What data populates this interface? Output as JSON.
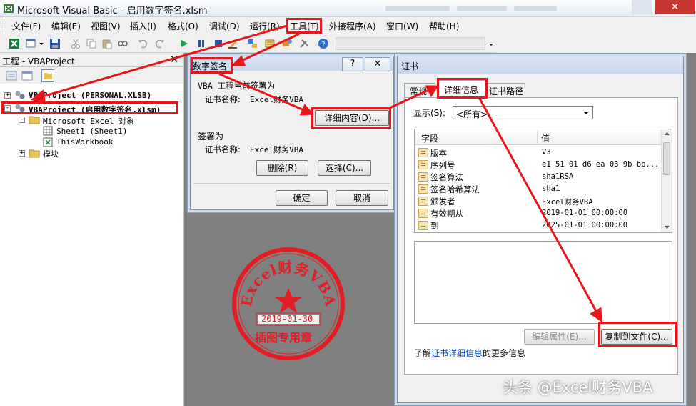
{
  "window": {
    "title": "Microsoft Visual Basic - 启用数字签名.xlsm",
    "close_label": "✕"
  },
  "menu": {
    "items": [
      "文件(F)",
      "编辑(E)",
      "视图(V)",
      "插入(I)",
      "格式(O)",
      "调试(D)",
      "运行(R)",
      "工具(T)",
      "外接程序(A)",
      "窗口(W)",
      "帮助(H)"
    ]
  },
  "project": {
    "title": "工程 - VBAProject",
    "close_label": "✕",
    "tree": [
      {
        "label": "VBAProject (PERSONAL.XLSB)",
        "toggle": "+"
      },
      {
        "label": "VBAProject (启用数字签名.xlsm)",
        "toggle": "-"
      },
      {
        "label": "Microsoft Excel 对象",
        "toggle": "-"
      },
      {
        "label": "Sheet1 (Sheet1)"
      },
      {
        "label": "ThisWorkbook"
      },
      {
        "label": "模块",
        "toggle": "+"
      }
    ]
  },
  "digital_signature": {
    "title": "数字签名",
    "help_label": "?",
    "close_label": "✕",
    "current_section": "VBA 工程当前签署为",
    "cert_name_label": "证书名称:",
    "cert_name_value": "Excel财务VBA",
    "details_button": "详细内容(D)...",
    "signed_as": "签署为",
    "cert_name_label2": "证书名称:",
    "cert_name_value2": "Excel财务VBA",
    "remove_button": "删除(R)",
    "choose_button": "选择(C)...",
    "ok_button": "确定",
    "cancel_button": "取消"
  },
  "certificate": {
    "title": "证书",
    "tabs": [
      "常规",
      "详细信息",
      "证书路径"
    ],
    "show_label": "显示(S):",
    "show_value": "<所有>",
    "col_field": "字段",
    "col_value": "值",
    "rows": [
      {
        "field": "版本",
        "value": "V3"
      },
      {
        "field": "序列号",
        "value": "e1 51 01 d6 ea 03 9b bb..."
      },
      {
        "field": "签名算法",
        "value": "sha1RSA"
      },
      {
        "field": "签名哈希算法",
        "value": "sha1"
      },
      {
        "field": "颁发者",
        "value": "Excel财务VBA"
      },
      {
        "field": "有效期从",
        "value": "2019-01-01 00:00:00"
      },
      {
        "field": "到",
        "value": "2025-01-01 00:00:00"
      }
    ],
    "edit_props_button": "编辑属性(E)...",
    "copy_to_file_button": "复制到文件(C)...",
    "learn_prefix": "了解",
    "learn_link": "证书详细信息",
    "learn_suffix": "的更多信息"
  },
  "stamp": {
    "top_text": "Excel财务VBA",
    "date": "2019-01-30",
    "bottom_text": "插图专用章"
  },
  "watermark": "头条 @Excel财务VBA",
  "colors": {
    "annotation_red": "#e8161b",
    "stamp_red": "#e21d23",
    "link_blue": "#0645ad"
  }
}
